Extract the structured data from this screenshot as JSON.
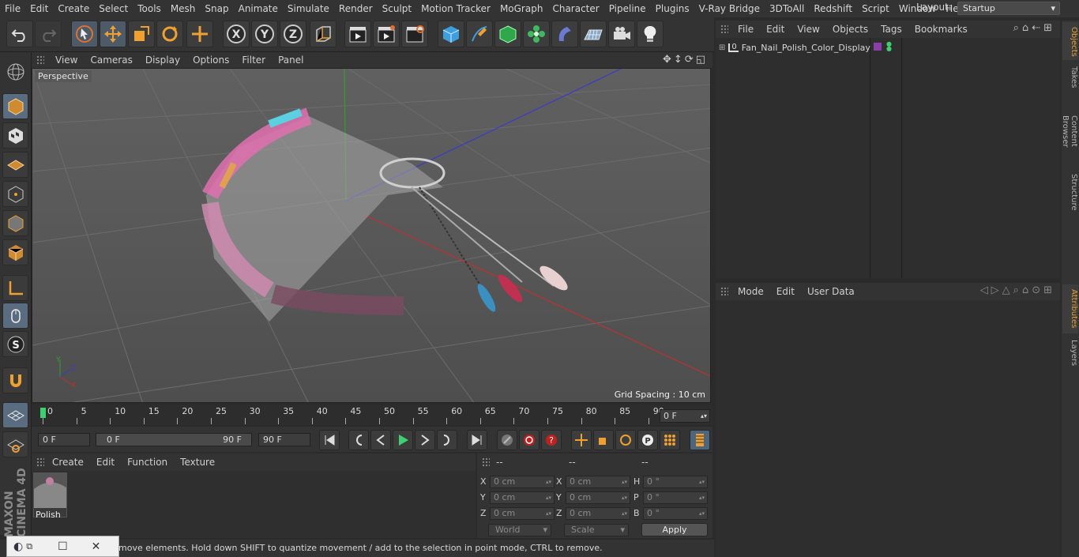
{
  "menu": [
    "File",
    "Edit",
    "Create",
    "Select",
    "Tools",
    "Mesh",
    "Snap",
    "Animate",
    "Simulate",
    "Render",
    "Sculpt",
    "Motion Tracker",
    "MoGraph",
    "Character",
    "Pipeline",
    "Plugins",
    "V-Ray Bridge",
    "3DToAll",
    "Redshift",
    "Script",
    "Window",
    "Help"
  ],
  "layout": {
    "label": "Layout:",
    "value": "Startup"
  },
  "viewport": {
    "menu": [
      "View",
      "Cameras",
      "Display",
      "Options",
      "Filter",
      "Panel"
    ],
    "label": "Perspective",
    "grid_spacing": "Grid Spacing : 10 cm",
    "axis_labels": {
      "y": "Y",
      "z": "Z",
      "x": "X"
    }
  },
  "timeline": {
    "ticks": [
      "0",
      "5",
      "10",
      "15",
      "20",
      "25",
      "30",
      "35",
      "40",
      "45",
      "50",
      "55",
      "60",
      "65",
      "70",
      "75",
      "80",
      "85",
      "90"
    ],
    "current_frame": "0 F"
  },
  "transport": {
    "start": "0 F",
    "range_start": "0 F",
    "range_end": "90 F",
    "end": "90 F"
  },
  "material_manager": {
    "menu": [
      "Create",
      "Edit",
      "Function",
      "Texture"
    ],
    "material_name": "Polish"
  },
  "coordinates": {
    "header": [
      "--",
      "--",
      "--"
    ],
    "rows": [
      {
        "l1": "X",
        "v1": "0 cm",
        "l2": "X",
        "v2": "0 cm",
        "l3": "H",
        "v3": "0 °"
      },
      {
        "l1": "Y",
        "v1": "0 cm",
        "l2": "Y",
        "v2": "0 cm",
        "l3": "P",
        "v3": "0 °"
      },
      {
        "l1": "Z",
        "v1": "0 cm",
        "l2": "Z",
        "v2": "0 cm",
        "l3": "B",
        "v3": "0 °"
      }
    ],
    "space": "World",
    "mode": "Scale",
    "apply": "Apply"
  },
  "status": "move elements. Hold down SHIFT to quantize movement / add to the selection in point mode, CTRL to remove.",
  "objects": {
    "menu": [
      "File",
      "Edit",
      "View",
      "Objects",
      "Tags",
      "Bookmarks"
    ],
    "items": [
      {
        "name": "Fan_Nail_Polish_Color_Display"
      }
    ]
  },
  "attributes": {
    "menu": [
      "Mode",
      "Edit",
      "User Data"
    ]
  },
  "right_tabs": [
    "Objects",
    "Takes",
    "Content Browser",
    "Structure",
    "Attributes",
    "Layers"
  ],
  "logo": "MAXON CINEMA 4D",
  "colors": {
    "accent": "#e6a030",
    "selection": "#5a6d80",
    "tag_purple": "#8a3ea8"
  }
}
